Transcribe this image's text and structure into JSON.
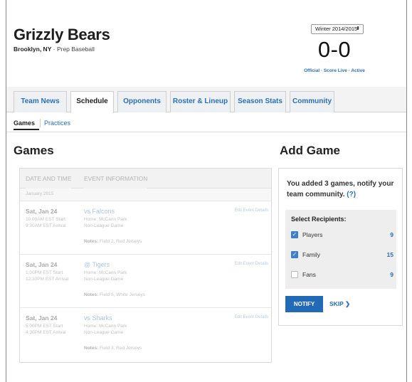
{
  "team": {
    "name": "Grizzly Bears",
    "location": "Brooklyn, NY",
    "separator": " · ",
    "division": "Prep Baseball"
  },
  "scoreboard": {
    "season": "Winter 2014/2015",
    "season_caret": "⬍",
    "record": "0-0",
    "status": "Official · Score Live · Active"
  },
  "tabs": [
    {
      "label": "Team News"
    },
    {
      "label": "Schedule",
      "active": true
    },
    {
      "label": "Opponents"
    },
    {
      "label": "Roster & Lineup"
    },
    {
      "label": "Season Stats"
    },
    {
      "label": "Community"
    }
  ],
  "subnav": {
    "games": "Games",
    "practices": "Practices"
  },
  "games_section": {
    "heading": "Games",
    "columns": [
      "DATE AND TIME",
      "EVENT INFORMATION"
    ],
    "month": "January 2015",
    "edit_label": "Edit Event Details",
    "notes_label": "Notes:",
    "games": [
      {
        "date": "Sat, Jan 24",
        "start": "10:00AM EST Start",
        "arrival": "9:30AM EST Arrival",
        "opponent": "vs Falcons",
        "home": "Home: McCann Park",
        "type": "Non-League Game",
        "notes": "Field 2, Red Jerseys"
      },
      {
        "date": "Sat, Jan 24",
        "start": "1:00PM EST Start",
        "arrival": "12:30PM EST Arrival",
        "opponent": "@ Tigers",
        "home": "Home: McCann Park",
        "type": "Non-League Game",
        "notes": "Field 6, White Jerseys"
      },
      {
        "date": "Sat, Jan 24",
        "start": "5:00PM EST Start",
        "arrival": "4:30PM EST Arrival",
        "opponent": "vs Sharks",
        "home": "Home: McCann Park",
        "type": "Non-League Game",
        "notes": "Field 3, Red Jerseys"
      }
    ]
  },
  "add_game": {
    "heading": "Add Game",
    "message": "You added 3 games, notify your team community.",
    "help": "(?)",
    "recipients_title": "Select Recipients:",
    "recipients": [
      {
        "label": "Players",
        "count": "9",
        "checked": true
      },
      {
        "label": "Family",
        "count": "15",
        "checked": true
      },
      {
        "label": "Fans",
        "count": "9",
        "checked": false
      }
    ],
    "notify_label": "NOTIFY",
    "skip_label": "SKIP ❯"
  },
  "colors": {
    "accent": "#2269b6",
    "link": "#2b6fb5",
    "checkbox": "#3b7fd0"
  }
}
